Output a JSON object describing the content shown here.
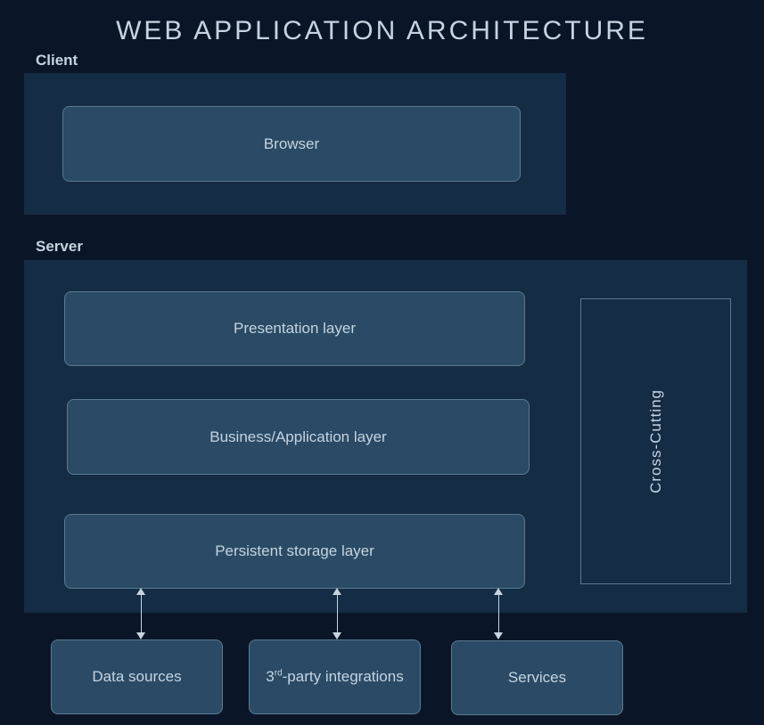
{
  "title": "WEB APPLICATION ARCHITECTURE",
  "sections": {
    "client_label": "Client",
    "server_label": "Server"
  },
  "blocks": {
    "browser": "Browser",
    "presentation": "Presentation layer",
    "business": "Business/Application layer",
    "persistent": "Persistent storage layer",
    "cross_cutting": "Cross-Cutting",
    "data_sources": "Data sources",
    "third_party_prefix": "3",
    "third_party_ord": "rd",
    "third_party_suffix": "-party integrations",
    "services": "Services"
  }
}
